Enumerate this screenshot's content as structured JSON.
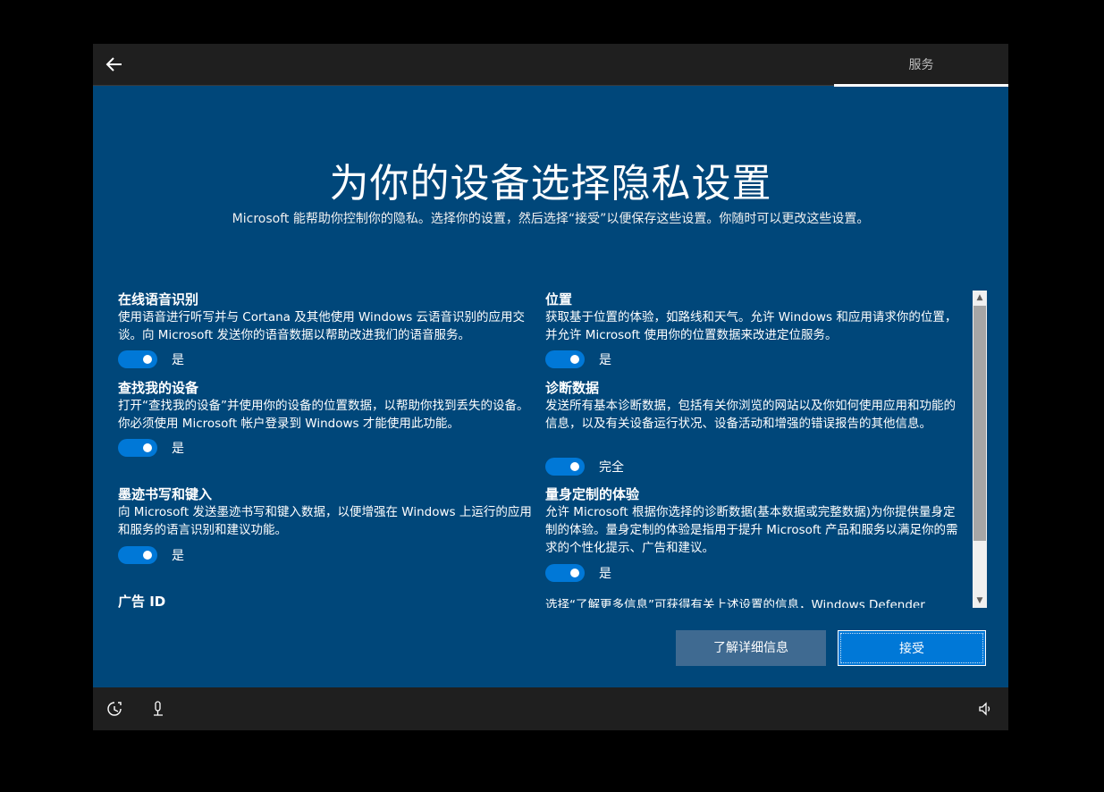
{
  "topbar": {
    "tab_label": "服务"
  },
  "header": {
    "title": "为你的设备选择隐私设置",
    "subtitle": "Microsoft 能帮助你控制你的隐私。选择你的设置，然后选择“接受”以便保存这些设置。你随时可以更改这些设置。"
  },
  "settings": {
    "left": [
      {
        "title": "在线语音识别",
        "description": "使用语音进行听写并与 Cortana 及其他使用 Windows 云语音识别的应用交谈。向 Microsoft 发送你的语音数据以帮助改进我们的语音服务。",
        "toggle_label": "是"
      },
      {
        "title": "查找我的设备",
        "description": "打开“查找我的设备”并使用你的设备的位置数据，以帮助你找到丢失的设备。你必须使用 Microsoft 帐户登录到 Windows 才能使用此功能。",
        "toggle_label": "是"
      },
      {
        "title": "墨迹书写和键入",
        "description": "向 Microsoft 发送墨迹书写和键入数据，以便增强在 Windows 上运行的应用和服务的语言识别和建议功能。",
        "toggle_label": "是"
      },
      {
        "title": "广告 ID"
      }
    ],
    "right": [
      {
        "title": "位置",
        "description": "获取基于位置的体验，如路线和天气。允许 Windows 和应用请求你的位置，并允许 Microsoft 使用你的位置数据来改进定位服务。",
        "toggle_label": "是"
      },
      {
        "title": "诊断数据",
        "description": "发送所有基本诊断数据，包括有关你浏览的网站以及你如何使用应用和功能的信息，以及有关设备运行状况、设备活动和增强的错误报告的其他信息。",
        "toggle_label": "完全"
      },
      {
        "title": "量身定制的体验",
        "description": "允许 Microsoft 根据你选择的诊断数据(基本数据或完整数据)为你提供量身定制的体验。量身定制的体验是指用于提升 Microsoft 产品和服务以满足你的需求的个性化提示、广告和建议。",
        "toggle_label": "是"
      },
      {
        "description": "选择“了解更多信息”可获得有关上述设置的信息，Windows Defender"
      }
    ]
  },
  "buttons": {
    "learn_more": "了解详细信息",
    "accept": "接受"
  },
  "colors": {
    "background": "#00477a",
    "toggle_on": "#0078d7",
    "bar": "#1f1f1f"
  },
  "icons": {
    "back": "back-arrow-icon",
    "ease_of_access": "ease-of-access-icon",
    "microphone": "microphone-icon",
    "volume": "volume-icon"
  }
}
